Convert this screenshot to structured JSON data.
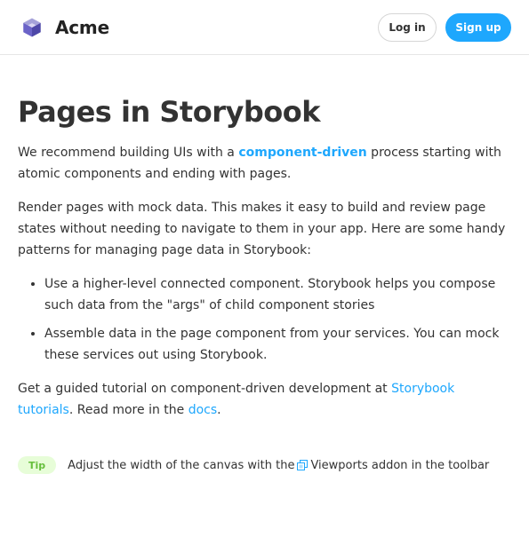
{
  "header": {
    "brand_name": "Acme",
    "logo_icon": "acme-cube-logo",
    "login_label": "Log in",
    "signup_label": "Sign up",
    "accent_color": "#1ea7fd"
  },
  "main": {
    "title": "Pages in Storybook",
    "para1": {
      "before": "We recommend building UIs with a ",
      "link": "component-driven",
      "after": " process starting with atomic components and ending with pages."
    },
    "para2": "Render pages with mock data. This makes it easy to build and review page states without needing to navigate to them in your app. Here are some handy patterns for managing page data in Storybook:",
    "bullets": [
      "Use a higher-level connected component. Storybook helps you compose such data from the \"args\" of child component stories",
      "Assemble data in the page component from your services. You can mock these services out using Storybook."
    ],
    "para3": {
      "before": "Get a guided tutorial on component-driven development at ",
      "link1": "Storybook tutorials",
      "middle": ". Read more in the ",
      "link2": "docs",
      "after": "."
    },
    "tip": {
      "badge": "Tip",
      "before": "Adjust the width of the canvas with the ",
      "icon": "viewport-icon",
      "after": "Viewports addon in the toolbar",
      "badge_color": "#66bf3c",
      "badge_bg": "#e7fdd8"
    }
  }
}
